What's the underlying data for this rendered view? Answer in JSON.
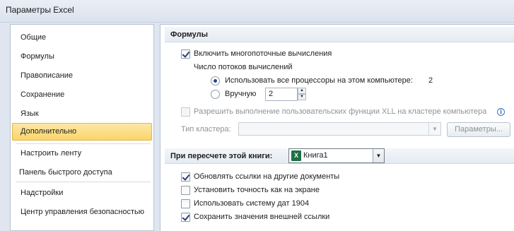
{
  "window": {
    "title": "Параметры Excel"
  },
  "sidebar": {
    "items": [
      {
        "label": "Общие"
      },
      {
        "label": "Формулы"
      },
      {
        "label": "Правописание"
      },
      {
        "label": "Сохранение"
      },
      {
        "label": "Язык"
      },
      {
        "label": "Дополнительно",
        "active": true
      },
      {
        "label": "Настроить ленту"
      },
      {
        "label": "Панель быстрого доступа"
      },
      {
        "label": "Надстройки"
      },
      {
        "label": "Центр управления безопасностью"
      }
    ]
  },
  "formulas_section": {
    "header": "Формулы",
    "multithread": {
      "label": "Включить многопоточные вычисления",
      "checked": true
    },
    "thread_count_label": "Число потоков вычислений",
    "use_all": {
      "label": "Использовать все процессоры на этом компьютере:",
      "count": "2",
      "selected": true
    },
    "manual": {
      "label": "Вручную",
      "value": "2",
      "selected": false
    },
    "xll": {
      "label": "Разрешить выполнение пользовательских функции XLL на кластере компьютера",
      "checked": false,
      "enabled": false
    },
    "cluster_type_label": "Тип кластера:",
    "cluster_type_value": "",
    "parameters_button": "Параметры..."
  },
  "recalc_section": {
    "header": "При пересчете этой книги:",
    "workbook": {
      "icon": "excel-workbook-icon",
      "value": "Книга1"
    },
    "options": [
      {
        "label": "Обновлять ссылки на другие документы",
        "checked": true
      },
      {
        "label": "Установить точность как на экране",
        "checked": false
      },
      {
        "label": "Использовать систему дат 1904",
        "checked": false
      },
      {
        "label": "Сохранить значения внешней ссылки",
        "checked": true
      }
    ]
  },
  "colors": {
    "active_item": "#fbd56a",
    "accent": "#1f4c8f",
    "excel_green": "#1e7145"
  }
}
